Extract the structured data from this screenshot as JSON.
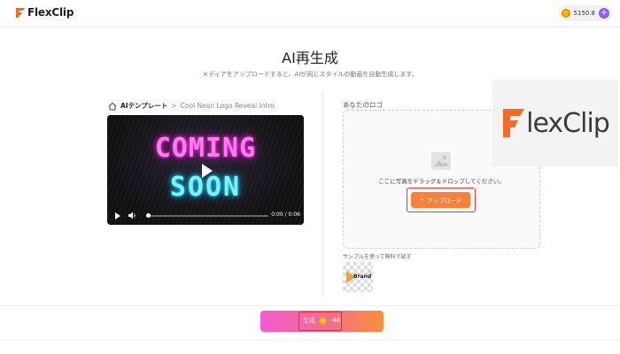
{
  "app": {
    "name": "FlexClip"
  },
  "header": {
    "credits": "5150.8",
    "plus": "+"
  },
  "page": {
    "title": "AI再生成",
    "subtitle": "メディアをアップロードすると、AIが同じスタイルの動画を自動生成します。"
  },
  "breadcrumb": {
    "root": "AIテンプレート",
    "separator": ">",
    "current": "Cool Neon Logo Reveal Intro"
  },
  "video": {
    "neon_line1": "COMING",
    "neon_line2": "SOON",
    "time": "0:00 / 0:06",
    "progress": 0.0
  },
  "logo_panel": {
    "label": "あなたのロゴ",
    "drop_text": "ここに写真をドラッグ＆ドロップしてください。",
    "upload_label": "アップロード",
    "upload_icon": "+",
    "sample_label": "サンプルを使って無料で試す",
    "sample_text": "Brand"
  },
  "preview": {
    "text": "lexClip"
  },
  "generate": {
    "label": "生成",
    "cost": "-46"
  },
  "colors": {
    "accent": "#f7803a",
    "highlight": "#e23b3b",
    "credit_plus": "#8c5cf5"
  }
}
